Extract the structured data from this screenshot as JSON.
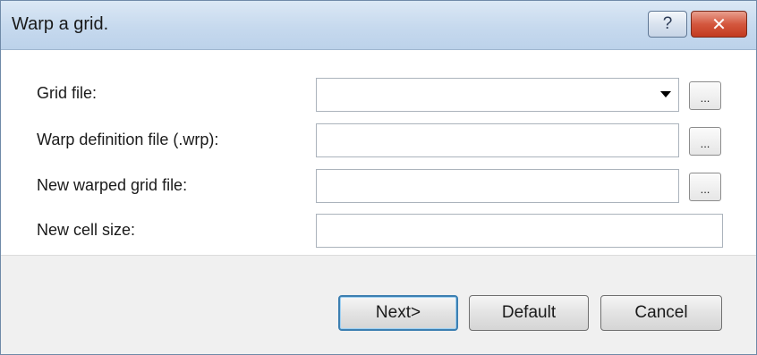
{
  "window": {
    "title": "Warp a grid.",
    "help_glyph": "?",
    "close_glyph": "✕"
  },
  "form": {
    "grid_file": {
      "label": "Grid file:",
      "value": ""
    },
    "warp_def": {
      "label": "Warp definition file (.wrp):",
      "value": ""
    },
    "new_grid": {
      "label": "New warped grid file:",
      "value": ""
    },
    "cell_size": {
      "label": "New cell size:",
      "value": ""
    },
    "browse_label": "..."
  },
  "buttons": {
    "next": "Next>",
    "default": "Default",
    "cancel": "Cancel"
  }
}
